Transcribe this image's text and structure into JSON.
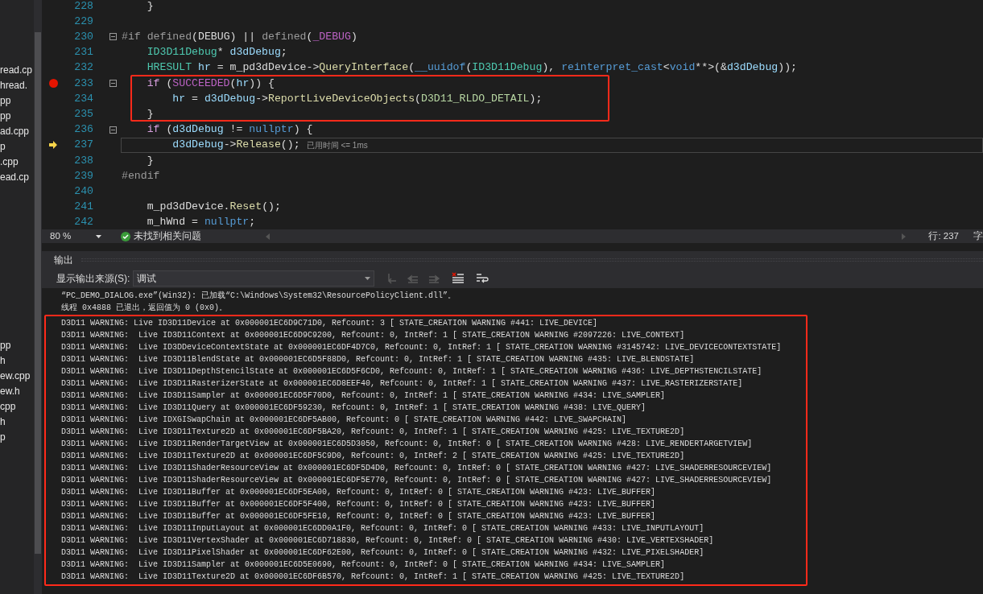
{
  "sidebar": {
    "groups": [
      {
        "items": [
          {
            "label": "read.cp"
          },
          {
            "label": "hread."
          },
          {
            "label": "pp"
          },
          {
            "label": "pp"
          },
          {
            "label": "ad.cpp"
          },
          {
            "label": "p"
          },
          {
            "label": ".cpp"
          },
          {
            "label": "ead.cp"
          }
        ]
      },
      {
        "items": [
          {
            "label": "pp"
          },
          {
            "label": "h"
          },
          {
            "label": "ew.cpp"
          },
          {
            "label": "ew.h"
          },
          {
            "label": "cpp"
          },
          {
            "label": "h"
          },
          {
            "label": "p"
          }
        ]
      }
    ]
  },
  "editor": {
    "lines": [
      {
        "number": "228",
        "breakpoint": false,
        "current": false,
        "fold": false,
        "segments": [
          {
            "kind": "plain",
            "text": "    }"
          }
        ]
      },
      {
        "number": "229",
        "breakpoint": false,
        "current": false,
        "fold": false
      },
      {
        "number": "230",
        "breakpoint": false,
        "current": false,
        "fold": true,
        "segments": [
          {
            "kind": "preproc",
            "text": "#if defined"
          },
          {
            "kind": "plain",
            "text": "(DEBUG) || "
          },
          {
            "kind": "preproc",
            "text": "defined"
          },
          {
            "kind": "plain",
            "text": "("
          },
          {
            "kind": "macro",
            "text": "_DEBUG"
          },
          {
            "kind": "plain",
            "text": ")"
          }
        ]
      },
      {
        "number": "231",
        "breakpoint": false,
        "current": false,
        "fold": false,
        "segments": [
          {
            "kind": "type",
            "text": "    ID3D11Debug"
          },
          {
            "kind": "plain",
            "text": "* "
          },
          {
            "kind": "var",
            "text": "d3dDebug"
          },
          {
            "kind": "plain",
            "text": ";"
          }
        ]
      },
      {
        "number": "232",
        "breakpoint": false,
        "current": false,
        "fold": false,
        "segments": [
          {
            "kind": "type",
            "text": "    HRESULT"
          },
          {
            "kind": "var",
            "text": " hr"
          },
          {
            "kind": "plain",
            "text": " = m_pd3dDevice->"
          },
          {
            "kind": "func",
            "text": "QueryInterface"
          },
          {
            "kind": "plain",
            "text": "("
          },
          {
            "kind": "keyword",
            "text": "__uuidof"
          },
          {
            "kind": "plain",
            "text": "("
          },
          {
            "kind": "type",
            "text": "ID3D11Debug"
          },
          {
            "kind": "plain",
            "text": "), "
          },
          {
            "kind": "keyword",
            "text": "reinterpret_cast"
          },
          {
            "kind": "plain",
            "text": "<"
          },
          {
            "kind": "keyword",
            "text": "void"
          },
          {
            "kind": "plain",
            "text": "**>(&"
          },
          {
            "kind": "var",
            "text": "d3dDebug"
          },
          {
            "kind": "plain",
            "text": "));"
          }
        ]
      },
      {
        "number": "233",
        "breakpoint": true,
        "current": false,
        "fold": true,
        "segments": [
          {
            "kind": "control",
            "text": "    if"
          },
          {
            "kind": "plain",
            "text": " ("
          },
          {
            "kind": "macro",
            "text": "SUCCEEDED"
          },
          {
            "kind": "plain",
            "text": "("
          },
          {
            "kind": "var",
            "text": "hr"
          },
          {
            "kind": "plain",
            "text": ")) {"
          }
        ]
      },
      {
        "number": "234",
        "breakpoint": false,
        "current": false,
        "fold": false,
        "segments": [
          {
            "kind": "var",
            "text": "        hr"
          },
          {
            "kind": "plain",
            "text": " = "
          },
          {
            "kind": "var",
            "text": "d3dDebug"
          },
          {
            "kind": "plain",
            "text": "->"
          },
          {
            "kind": "func",
            "text": "ReportLiveDeviceObjects"
          },
          {
            "kind": "plain",
            "text": "("
          },
          {
            "kind": "enum",
            "text": "D3D11_RLDO_DETAIL"
          },
          {
            "kind": "plain",
            "text": ");"
          }
        ]
      },
      {
        "number": "235",
        "breakpoint": false,
        "current": false,
        "fold": false,
        "segments": [
          {
            "kind": "plain",
            "text": "    }"
          }
        ]
      },
      {
        "number": "236",
        "breakpoint": false,
        "current": false,
        "fold": true,
        "segments": [
          {
            "kind": "control",
            "text": "    if"
          },
          {
            "kind": "plain",
            "text": " ("
          },
          {
            "kind": "var",
            "text": "d3dDebug"
          },
          {
            "kind": "plain",
            "text": " != "
          },
          {
            "kind": "keyword",
            "text": "nullptr"
          },
          {
            "kind": "plain",
            "text": ") {"
          }
        ]
      },
      {
        "number": "237",
        "breakpoint": false,
        "current": true,
        "fold": false,
        "hint": "已用时间 <= 1ms",
        "segments": [
          {
            "kind": "var",
            "text": "        d3dDebug"
          },
          {
            "kind": "plain",
            "text": "->"
          },
          {
            "kind": "func",
            "text": "Release"
          },
          {
            "kind": "plain",
            "text": "();"
          }
        ]
      },
      {
        "number": "238",
        "breakpoint": false,
        "current": false,
        "fold": false,
        "segments": [
          {
            "kind": "plain",
            "text": "    }"
          }
        ]
      },
      {
        "number": "239",
        "breakpoint": false,
        "current": false,
        "fold": false,
        "segments": [
          {
            "kind": "preproc",
            "text": "#endif"
          }
        ]
      },
      {
        "number": "240",
        "breakpoint": false,
        "current": false,
        "fold": false
      },
      {
        "number": "241",
        "breakpoint": false,
        "current": false,
        "fold": false,
        "segments": [
          {
            "kind": "plain",
            "text": "    m_pd3dDevice."
          },
          {
            "kind": "func",
            "text": "Reset"
          },
          {
            "kind": "plain",
            "text": "();"
          }
        ]
      },
      {
        "number": "242",
        "breakpoint": false,
        "current": false,
        "fold": false,
        "segments": [
          {
            "kind": "plain",
            "text": "    m_hWnd = "
          },
          {
            "kind": "keyword",
            "text": "nullptr"
          },
          {
            "kind": "plain",
            "text": ";"
          }
        ]
      }
    ]
  },
  "status_bar": {
    "zoom": "80 %",
    "issues": "未找到相关问题",
    "line": "行: 237",
    "column": "字"
  },
  "output": {
    "title": "输出",
    "source_label": "显示输出来源(S):",
    "source_value": "调试",
    "lines": [
      "“PC_DEMO_DIALOG.exe”(Win32): 已加载“C:\\Windows\\System32\\ResourcePolicyClient.dll”。",
      "线程 0x4888 已退出，返回值为 0 (0x0)。"
    ],
    "warnings": [
      "D3D11 WARNING: Live ID3D11Device at 0x000001EC6D9C71D0, Refcount: 3 [ STATE_CREATION WARNING #441: LIVE_DEVICE]",
      "D3D11 WARNING:  Live ID3D11Context at 0x000001EC6D9C9200, Refcount: 0, IntRef: 1 [ STATE_CREATION WARNING #2097226: LIVE_CONTEXT]",
      "D3D11 WARNING:  Live ID3DDeviceContextState at 0x000001EC6DF4D7C0, Refcount: 0, IntRef: 1 [ STATE_CREATION WARNING #3145742: LIVE_DEVICECONTEXTSTATE]",
      "D3D11 WARNING:  Live ID3D11BlendState at 0x000001EC6D5F88D0, Refcount: 0, IntRef: 1 [ STATE_CREATION WARNING #435: LIVE_BLENDSTATE]",
      "D3D11 WARNING:  Live ID3D11DepthStencilState at 0x000001EC6D5F6CD0, Refcount: 0, IntRef: 1 [ STATE_CREATION WARNING #436: LIVE_DEPTHSTENCILSTATE]",
      "D3D11 WARNING:  Live ID3D11RasterizerState at 0x000001EC6D8EEF40, Refcount: 0, IntRef: 1 [ STATE_CREATION WARNING #437: LIVE_RASTERIZERSTATE]",
      "D3D11 WARNING:  Live ID3D11Sampler at 0x000001EC6D5F70D0, Refcount: 0, IntRef: 1 [ STATE_CREATION WARNING #434: LIVE_SAMPLER]",
      "D3D11 WARNING:  Live ID3D11Query at 0x000001EC6DF59230, Refcount: 0, IntRef: 1 [ STATE_CREATION WARNING #438: LIVE_QUERY]",
      "D3D11 WARNING:  Live IDXGISwapChain at 0x000001EC6DF5AB00, Refcount: 0 [ STATE_CREATION WARNING #442: LIVE_SWAPCHAIN]",
      "D3D11 WARNING:  Live ID3D11Texture2D at 0x000001EC6DF5BA20, Refcount: 0, IntRef: 1 [ STATE_CREATION WARNING #425: LIVE_TEXTURE2D]",
      "D3D11 WARNING:  Live ID3D11RenderTargetView at 0x000001EC6D5D3050, Refcount: 0, IntRef: 0 [ STATE_CREATION WARNING #428: LIVE_RENDERTARGETVIEW]",
      "D3D11 WARNING:  Live ID3D11Texture2D at 0x000001EC6DF5C9D0, Refcount: 0, IntRef: 2 [ STATE_CREATION WARNING #425: LIVE_TEXTURE2D]",
      "D3D11 WARNING:  Live ID3D11ShaderResourceView at 0x000001EC6DF5D4D0, Refcount: 0, IntRef: 0 [ STATE_CREATION WARNING #427: LIVE_SHADERRESOURCEVIEW]",
      "D3D11 WARNING:  Live ID3D11ShaderResourceView at 0x000001EC6DF5E770, Refcount: 0, IntRef: 0 [ STATE_CREATION WARNING #427: LIVE_SHADERRESOURCEVIEW]",
      "D3D11 WARNING:  Live ID3D11Buffer at 0x000001EC6DF5EA00, Refcount: 0, IntRef: 0 [ STATE_CREATION WARNING #423: LIVE_BUFFER]",
      "D3D11 WARNING:  Live ID3D11Buffer at 0x000001EC6DF5F400, Refcount: 0, IntRef: 0 [ STATE_CREATION WARNING #423: LIVE_BUFFER]",
      "D3D11 WARNING:  Live ID3D11Buffer at 0x000001EC6DF5FE10, Refcount: 0, IntRef: 0 [ STATE_CREATION WARNING #423: LIVE_BUFFER]",
      "D3D11 WARNING:  Live ID3D11InputLayout at 0x000001EC6DD0A1F0, Refcount: 0, IntRef: 0 [ STATE_CREATION WARNING #433: LIVE_INPUTLAYOUT]",
      "D3D11 WARNING:  Live ID3D11VertexShader at 0x000001EC6D718830, Refcount: 0, IntRef: 0 [ STATE_CREATION WARNING #430: LIVE_VERTEXSHADER]",
      "D3D11 WARNING:  Live ID3D11PixelShader at 0x000001EC6DF62E00, Refcount: 0, IntRef: 0 [ STATE_CREATION WARNING #432: LIVE_PIXELSHADER]",
      "D3D11 WARNING:  Live ID3D11Sampler at 0x000001EC6D5E0690, Refcount: 0, IntRef: 0 [ STATE_CREATION WARNING #434: LIVE_SAMPLER]",
      "D3D11 WARNING:  Live ID3D11Texture2D at 0x000001EC6DF6B570, Refcount: 0, IntRef: 1 [ STATE_CREATION WARNING #425: LIVE_TEXTURE2D]"
    ]
  }
}
